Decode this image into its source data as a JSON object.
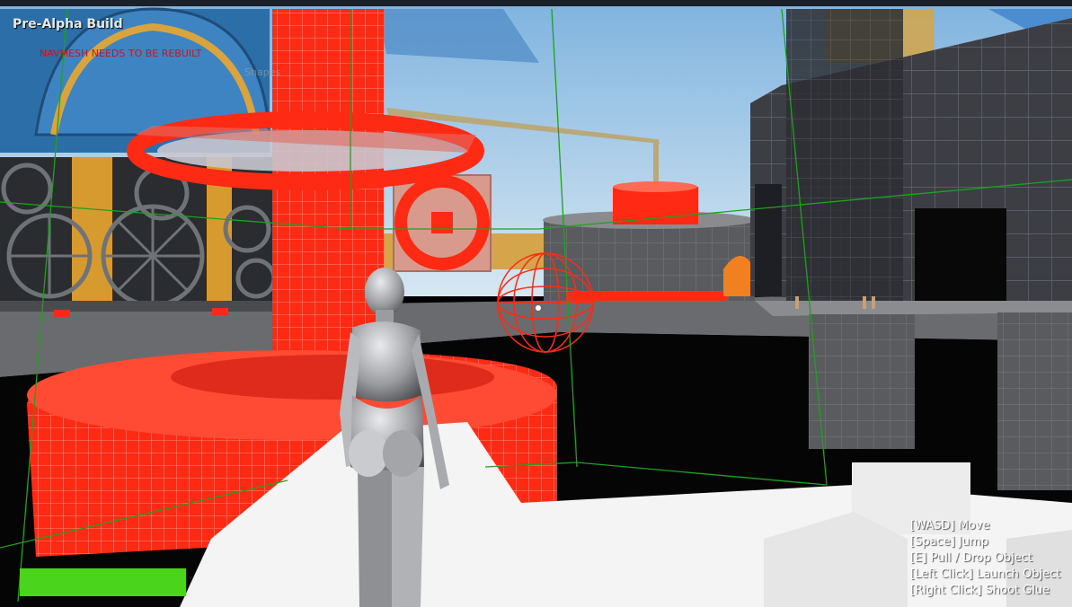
{
  "hud": {
    "build_label": "Pre-Alpha Build",
    "navmesh_warning": "NAVMESH NEEDS TO BE REBUILT",
    "faint_label": "Shapes",
    "health": {
      "fraction": 1.0,
      "color": "#4ad41c"
    },
    "controls": [
      "[WASD] Move",
      "[Space] Jump",
      "[E] Pull / Drop Object",
      "[Left Click] Launch Object",
      "[Right Click] Shoot Glue"
    ]
  },
  "scene": {
    "sky_color": "#a9cde6",
    "accent_red": "#ff2a14",
    "floor_white": "#f4f4f4",
    "wall_dark": "#3e4046",
    "wireframe_green": "#1ea21e"
  }
}
